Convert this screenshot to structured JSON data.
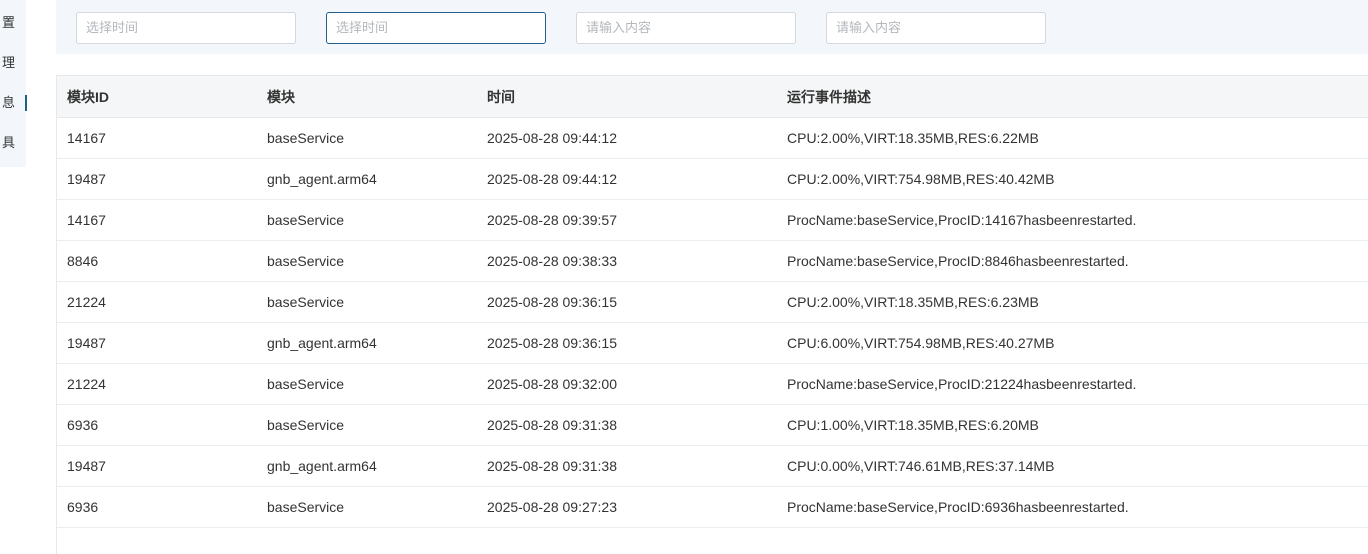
{
  "sidebar": {
    "items": [
      {
        "label": "置",
        "active": false
      },
      {
        "label": "理",
        "active": false
      },
      {
        "label": "息",
        "active": true
      },
      {
        "label": "具",
        "active": false
      }
    ]
  },
  "filters": {
    "start_time_placeholder": "选择时间",
    "end_time_placeholder": "选择时间",
    "input1_placeholder": "请输入内容",
    "input2_placeholder": "请输入内容"
  },
  "table": {
    "headers": [
      "模块ID",
      "模块",
      "时间",
      "运行事件描述"
    ],
    "rows": [
      [
        "14167",
        "baseService",
        "2025-08-28 09:44:12",
        "CPU:2.00%,VIRT:18.35MB,RES:6.22MB"
      ],
      [
        "19487",
        "gnb_agent.arm64",
        "2025-08-28 09:44:12",
        "CPU:2.00%,VIRT:754.98MB,RES:40.42MB"
      ],
      [
        "14167",
        "baseService",
        "2025-08-28 09:39:57",
        "ProcName:baseService,ProcID:14167hasbeenrestarted."
      ],
      [
        "8846",
        "baseService",
        "2025-08-28 09:38:33",
        "ProcName:baseService,ProcID:8846hasbeenrestarted."
      ],
      [
        "21224",
        "baseService",
        "2025-08-28 09:36:15",
        "CPU:2.00%,VIRT:18.35MB,RES:6.23MB"
      ],
      [
        "19487",
        "gnb_agent.arm64",
        "2025-08-28 09:36:15",
        "CPU:6.00%,VIRT:754.98MB,RES:40.27MB"
      ],
      [
        "21224",
        "baseService",
        "2025-08-28 09:32:00",
        "ProcName:baseService,ProcID:21224hasbeenrestarted."
      ],
      [
        "6936",
        "baseService",
        "2025-08-28 09:31:38",
        "CPU:1.00%,VIRT:18.35MB,RES:6.20MB"
      ],
      [
        "19487",
        "gnb_agent.arm64",
        "2025-08-28 09:31:38",
        "CPU:0.00%,VIRT:746.61MB,RES:37.14MB"
      ],
      [
        "6936",
        "baseService",
        "2025-08-28 09:27:23",
        "ProcName:baseService,ProcID:6936hasbeenrestarted."
      ]
    ]
  }
}
